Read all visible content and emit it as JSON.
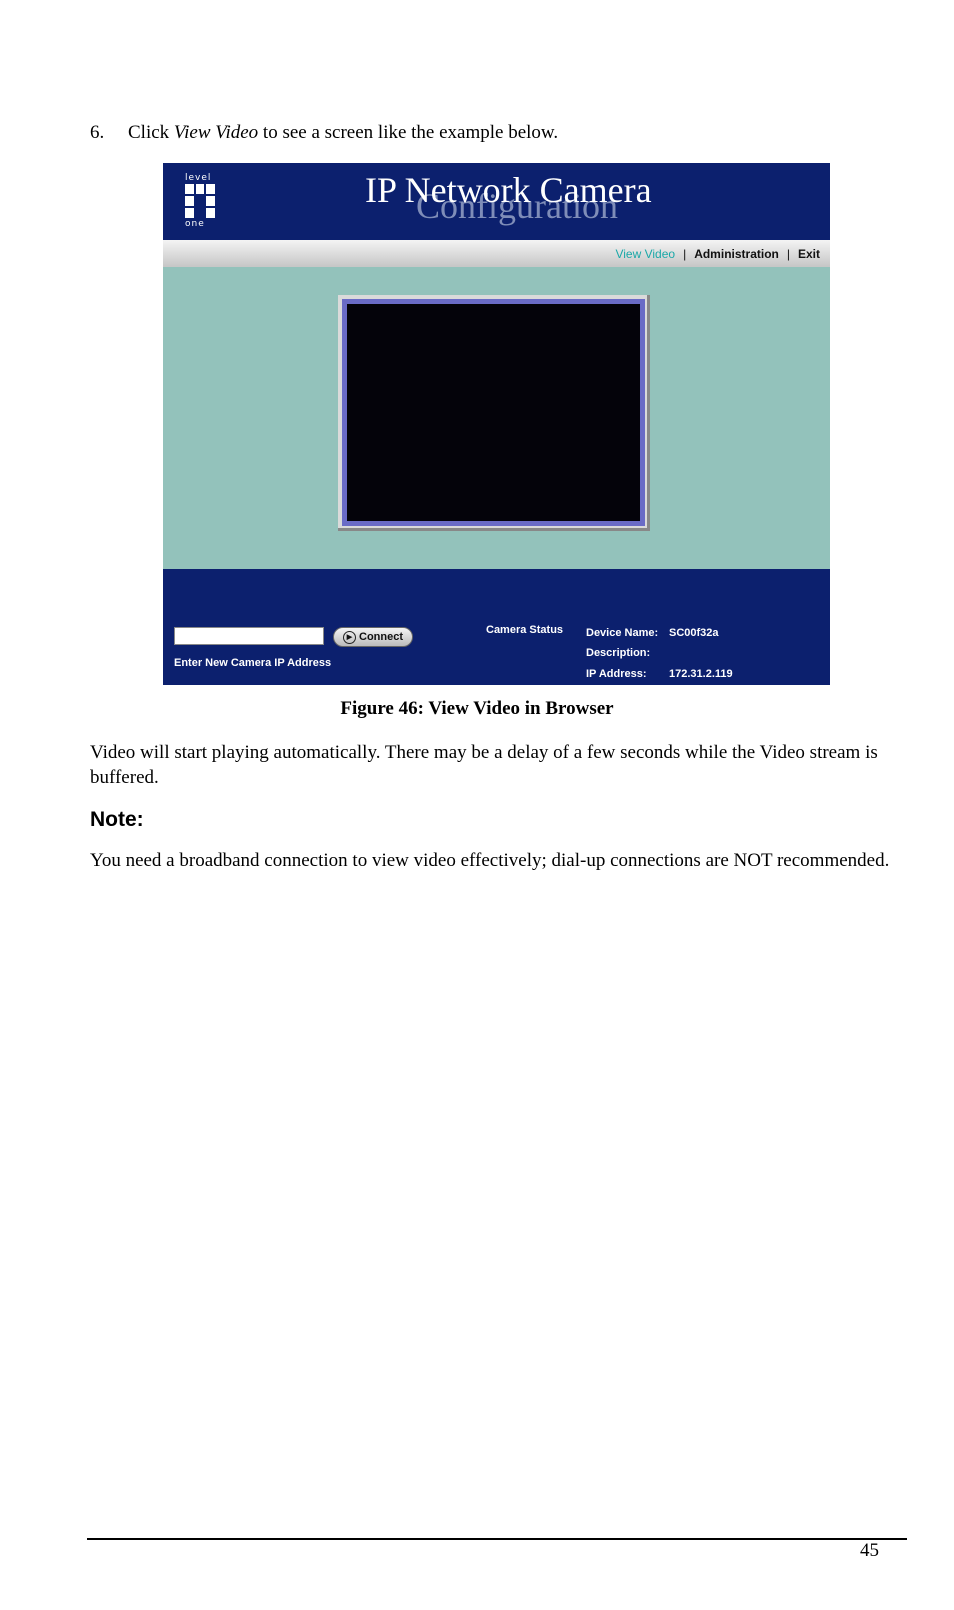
{
  "step": {
    "number": "6.",
    "pre": "Click ",
    "emphasis": "View Video",
    "post": " to see a screen like the example below."
  },
  "screenshot": {
    "logo": {
      "top": "level",
      "bottom": "one"
    },
    "title": "IP Network Camera",
    "subtitle": "Configuration",
    "nav": {
      "items": [
        "View Video",
        "Administration",
        "Exit"
      ],
      "separator": "|",
      "active": "View Video"
    },
    "video": {
      "state": "blank"
    },
    "connect": {
      "input_value": "",
      "button_label": "Connect",
      "button_icon": "play-circle-icon",
      "input_label": "Enter New Camera IP Address"
    },
    "camera_status": {
      "heading": "Camera Status",
      "fields": [
        {
          "label": "Device Name:",
          "value": "SC00f32a"
        },
        {
          "label": "Description:",
          "value": ""
        },
        {
          "label": "IP Address:",
          "value": "172.31.2.119"
        }
      ]
    },
    "colors": {
      "banner": "#0c206e",
      "content_bg": "#93c2bb",
      "video_border": "#6a6bc6",
      "nav_active": "#1aa8a8"
    }
  },
  "caption": "Figure 46: View Video in Browser",
  "paragraph1": "Video will start playing automatically. There may be a delay of a few seconds while the Video stream is buffered.",
  "note": {
    "heading": "Note:",
    "text": "You need a broadband connection to view video effectively; dial-up connections are NOT recommended."
  },
  "page_number": "45"
}
